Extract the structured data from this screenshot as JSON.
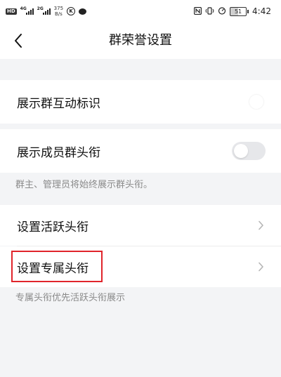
{
  "status_bar": {
    "hd_label": "HD",
    "signal_1_tag": "4G",
    "signal_2_tag": "2G",
    "net_speed_value": "375",
    "net_speed_unit": "B/s",
    "k_icon_label": "K",
    "battery_level": "51",
    "time": "4:42",
    "icons": [
      "hd-icon",
      "signal-icon",
      "signal-icon",
      "k-icon",
      "chat-icon",
      "nfc-icon",
      "vibrate-icon",
      "alarm-icon",
      "battery-icon"
    ]
  },
  "nav": {
    "title": "群荣誉设置",
    "back_icon": "chevron-left-icon"
  },
  "settings": {
    "group_interaction_label": "展示群互动标识",
    "member_title_label": "展示成员群头衔",
    "member_title_hint": "群主、管理员将始终展示群头衔。",
    "active_title_label": "设置活跃头衔",
    "exclusive_title_label": "设置专属头衔",
    "exclusive_title_hint": "专属头衔优先活跃头衔展示"
  },
  "colors": {
    "highlight": "#e0242b",
    "background": "#f3f4f6",
    "toggle_off": "#e6e7ea",
    "hint_text": "#8a8a8a"
  }
}
